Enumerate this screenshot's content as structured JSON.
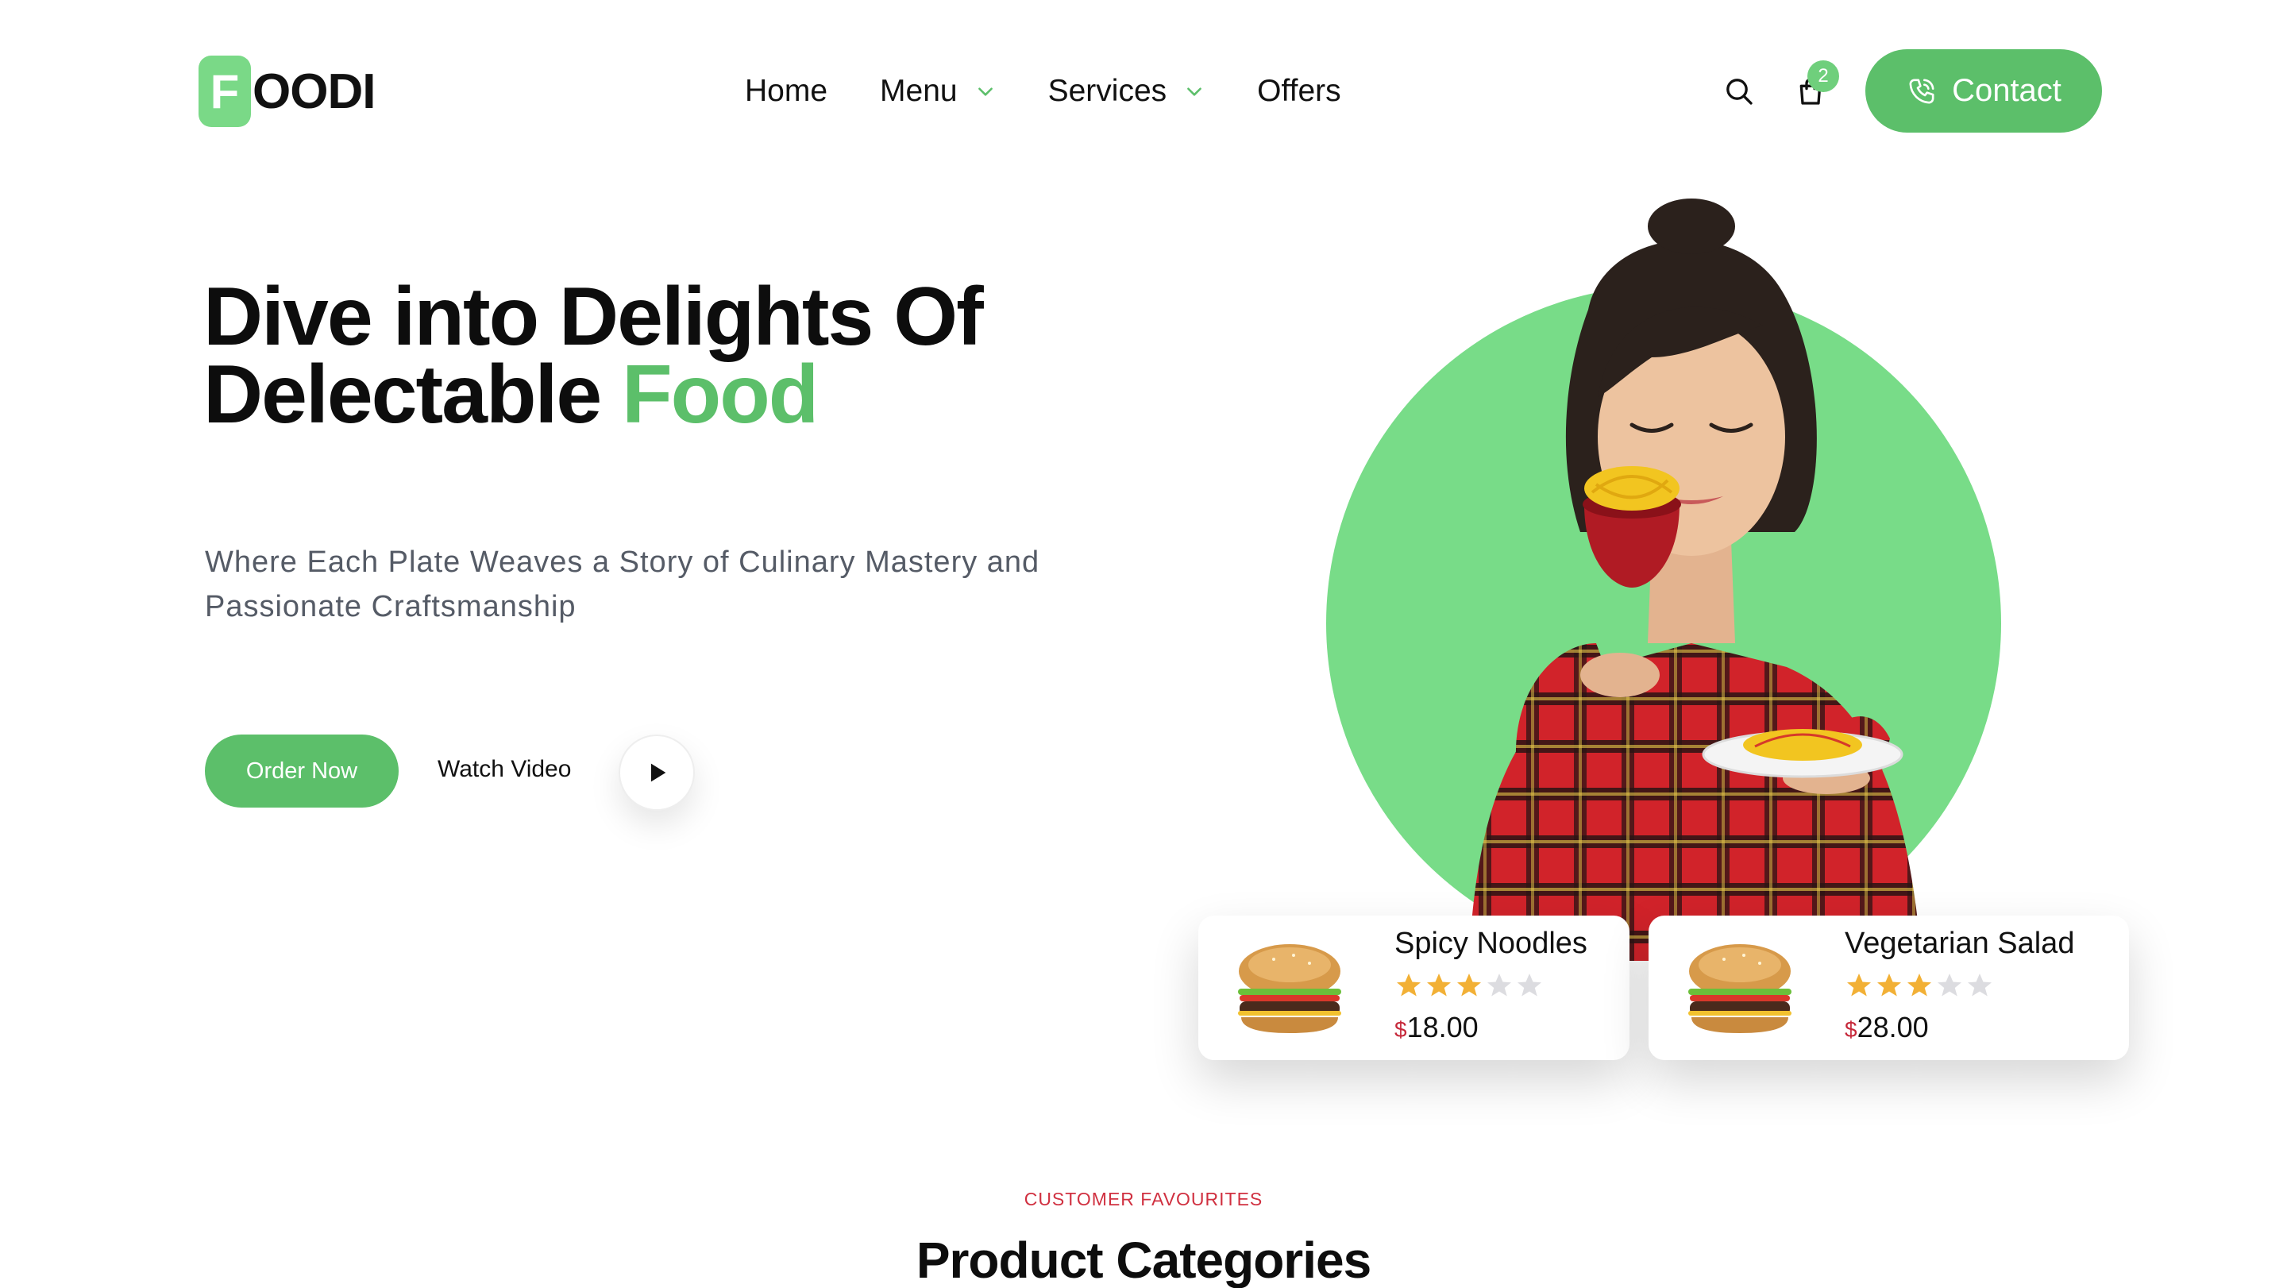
{
  "logo": {
    "mark": "F",
    "rest": "OODI"
  },
  "nav": {
    "items": [
      {
        "label": "Home",
        "has_dropdown": false
      },
      {
        "label": "Menu",
        "has_dropdown": true
      },
      {
        "label": "Services",
        "has_dropdown": true
      },
      {
        "label": "Offers",
        "has_dropdown": false
      }
    ]
  },
  "header": {
    "search_icon": "search-icon",
    "cart_icon": "shopping-bag-icon",
    "cart_count": "2",
    "contact_label": "Contact",
    "contact_icon": "phone-icon"
  },
  "hero": {
    "title_line1": "Dive into Delights Of",
    "title_line2_plain": "Delectable ",
    "title_line2_accent": "Food",
    "subtitle": "Where Each Plate Weaves a Story of Culinary Mastery and Passionate Craftsmanship",
    "order_label": "Order Now",
    "watch_label": "Watch Video"
  },
  "cards": [
    {
      "name": "Spicy Noodles",
      "rating": 3,
      "max_rating": 5,
      "currency": "$",
      "price": "18.00"
    },
    {
      "name": "Vegetarian Salad",
      "rating": 3,
      "max_rating": 5,
      "currency": "$",
      "price": "28.00"
    }
  ],
  "section": {
    "kicker": "CUSTOMER FAVOURITES",
    "title": "Product Categories"
  },
  "colors": {
    "brand_green": "#5cbf6a",
    "circle_green": "#78dc88",
    "price_currency_red": "#c6283a",
    "star_gold": "#f2b035",
    "star_empty": "#dcdce0"
  }
}
